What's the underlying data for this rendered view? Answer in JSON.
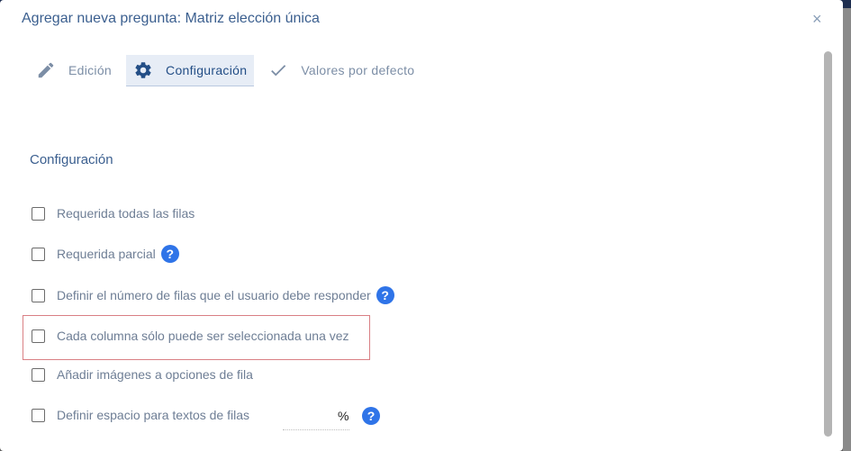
{
  "dialog": {
    "title": "Agregar nueva pregunta: Matriz elección única",
    "close_glyph": "×"
  },
  "tabs": [
    {
      "label": "Edición",
      "icon": "pencil-icon",
      "active": false
    },
    {
      "label": "Configuración",
      "icon": "gear-icon",
      "active": true
    },
    {
      "label": "Valores por defecto",
      "icon": "checkmark-icon",
      "active": false
    }
  ],
  "section": {
    "title": "Configuración"
  },
  "options": [
    {
      "label": "Requerida todas las filas",
      "checked": false,
      "help": false
    },
    {
      "label": "Requerida parcial",
      "checked": false,
      "help": true
    },
    {
      "label": "Definir el número de filas que el usuario debe responder",
      "checked": false,
      "help": true
    },
    {
      "label": "Cada columna sólo puede ser seleccionada una vez",
      "checked": false,
      "help": false,
      "highlighted": true
    },
    {
      "label": "Añadir imágenes a opciones de fila",
      "checked": false,
      "help": false
    },
    {
      "label": "Definir espacio para textos de filas",
      "checked": false,
      "help": true
    }
  ],
  "percent_symbol": "%",
  "help_glyph": "?",
  "colors": {
    "accent": "#2f74e8",
    "title": "#3b5f8f",
    "highlight_border": "#d97f84"
  }
}
